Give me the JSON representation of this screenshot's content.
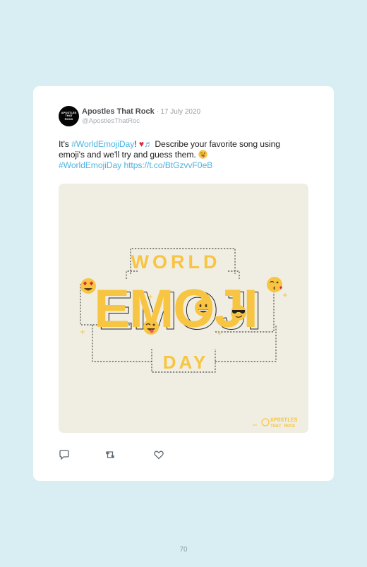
{
  "tweet": {
    "author_name": "Apostles That Rock",
    "separator": "·",
    "date": "17 July 2020",
    "handle": "@ApostlesThatRoc",
    "avatar_text": [
      "APOSTLES",
      "THAT",
      "ROCK"
    ],
    "text_prefix": "It's ",
    "hashtag_1": "#WorldEmojiDay",
    "text_after_hashtag": "!",
    "text_body": " Describe your favorite song using emoji's and we'll try and guess them.",
    "hashtag_2": "#WorldEmojiDay",
    "short_link": "https://t.co/BtGzvvF0eB",
    "emojis": [
      "red-heart",
      "musical-notes",
      "winking-face-with-tongue"
    ]
  },
  "media": {
    "title_top": "WORLD",
    "title_main": "EMOJI",
    "title_bottom": "DAY",
    "watermark_line1": "APOSTLES",
    "watermark_line2": "THAT ROCK",
    "emojis": [
      "heart-eyes-face",
      "grinning-face",
      "sunglasses-face",
      "winking-face-with-tongue",
      "kissing-face"
    ],
    "colors": {
      "background": "#f0eee3",
      "accent": "#f7c542"
    }
  },
  "actions": [
    {
      "icon": "reply-icon"
    },
    {
      "icon": "retweet-icon"
    },
    {
      "icon": "like-icon"
    }
  ],
  "page_number": "70"
}
